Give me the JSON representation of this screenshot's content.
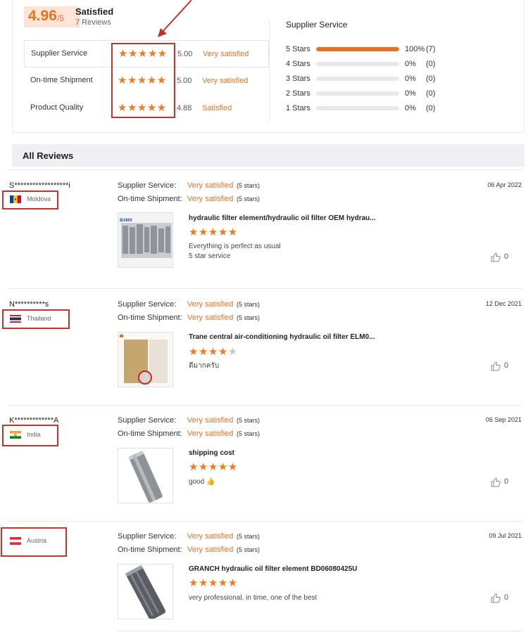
{
  "summary": {
    "score": "4.96",
    "score_of": "/5",
    "status": "Satisfied",
    "review_count": "7 Reviews",
    "ratings": [
      {
        "label": "Supplier Service",
        "value": "5.00",
        "text": "Very satisfied",
        "stars": 5
      },
      {
        "label": "On-time Shipment",
        "value": "5.00",
        "text": "Very satisfied",
        "stars": 5
      },
      {
        "label": "Product Quality",
        "value": "4.88",
        "text": "Satisfied",
        "stars": 5
      }
    ],
    "breakdown_title": "Supplier Service",
    "breakdown": [
      {
        "label": "5 Stars",
        "percent": "100%",
        "count": "(7)",
        "fraction": 1.0
      },
      {
        "label": "4 Stars",
        "percent": "0%",
        "count": "(0)",
        "fraction": 0
      },
      {
        "label": "3 Stars",
        "percent": "0%",
        "count": "(0)",
        "fraction": 0
      },
      {
        "label": "2 Stars",
        "percent": "0%",
        "count": "(0)",
        "fraction": 0
      },
      {
        "label": "1 Stars",
        "percent": "0%",
        "count": "(0)",
        "fraction": 0
      }
    ]
  },
  "all_reviews_title": "All Reviews",
  "labels": {
    "supplier_service": "Supplier Service:",
    "on_time_shipment": "On-time Shipment:"
  },
  "reviews": [
    {
      "name": "S******************i",
      "country": "Moldova",
      "flag": "moldova-flag",
      "date": "06 Apr 2022",
      "supplier": "Very satisfied",
      "supplier_stars": "(5 stars)",
      "shipment": "Very satisfied",
      "shipment_stars": "(5 stars)",
      "product": "hydraulic filter element/hydraulic oil filter OEM hydrau...",
      "product_stars": 5,
      "comment_1": "Everything is perfect as usual",
      "comment_2": "5 star service",
      "likes": "0"
    },
    {
      "name": "N**********s",
      "country": "Thailand",
      "flag": "thailand-flag",
      "date": "12 Dec 2021",
      "supplier": "Very satisfied",
      "supplier_stars": "(5 stars)",
      "shipment": "Very satisfied",
      "shipment_stars": "(5 stars)",
      "product": "Trane central air-conditioning hydraulic oil filter ELM0...",
      "product_stars": 4,
      "comment_1": "ดีมากครับ",
      "comment_2": "",
      "likes": "0"
    },
    {
      "name": "K*************A",
      "country": "India",
      "flag": "india-flag",
      "date": "06 Sep 2021",
      "supplier": "Very satisfied",
      "supplier_stars": "(5 stars)",
      "shipment": "Very satisfied",
      "shipment_stars": "(5 stars)",
      "product": "shipping cost",
      "product_stars": 5,
      "comment_1": "good 👍",
      "comment_2": "",
      "likes": "0"
    },
    {
      "name": "",
      "country": "Austria",
      "flag": "austria-flag",
      "date": "09 Jul 2021",
      "supplier": "Very satisfied",
      "supplier_stars": "(5 stars)",
      "shipment": "Very satisfied",
      "shipment_stars": "(5 stars)",
      "product": "GRANCH hydraulic oil filter element BD06080425U",
      "product_stars": 5,
      "comment_1": "very professional, in time, one of the best",
      "comment_2": "",
      "likes": "0"
    }
  ],
  "icons": {
    "star": "star-icon",
    "like": "thumbs-up-icon"
  },
  "colors": {
    "accent": "#e8711f",
    "annotation": "#c8322b"
  }
}
